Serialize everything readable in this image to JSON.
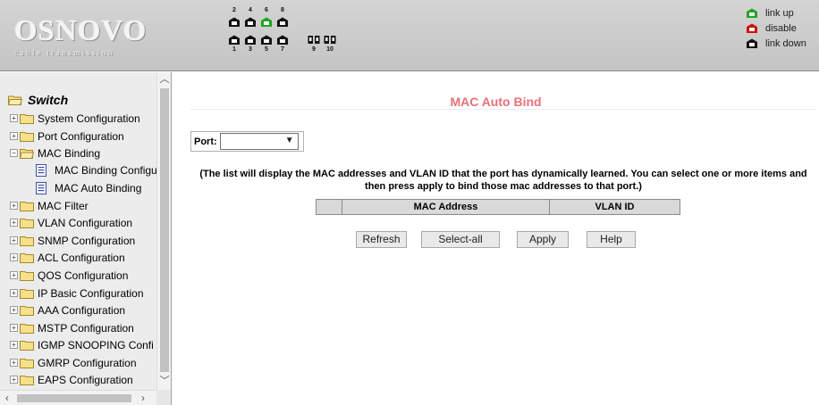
{
  "header": {
    "logo_name": "OSNOVO",
    "logo_tagline": "cable transmission",
    "port_labels_top": [
      "2",
      "4",
      "6",
      "8"
    ],
    "port_labels_bottom": [
      "1",
      "3",
      "5",
      "7",
      "9",
      "10"
    ],
    "ports": [
      {
        "label": "1",
        "status": "link down"
      },
      {
        "label": "2",
        "status": "link down"
      },
      {
        "label": "3",
        "status": "link down"
      },
      {
        "label": "4",
        "status": "link down"
      },
      {
        "label": "5",
        "status": "link down"
      },
      {
        "label": "6",
        "status": "link up"
      },
      {
        "label": "7",
        "status": "link down"
      },
      {
        "label": "8",
        "status": "link down"
      },
      {
        "label": "9",
        "status": "link down"
      },
      {
        "label": "10",
        "status": "link down"
      }
    ],
    "legend": [
      {
        "label": "link up",
        "color": "#1fa51f"
      },
      {
        "label": "disable",
        "color": "#cc1111"
      },
      {
        "label": "link down",
        "color": "#111111"
      }
    ]
  },
  "sidebar": {
    "root_label": "Switch",
    "items": [
      {
        "label": "System Configuration",
        "type": "folder",
        "expanded": false
      },
      {
        "label": "Port Configuration",
        "type": "folder",
        "expanded": false
      },
      {
        "label": "MAC Binding",
        "type": "folder",
        "expanded": true
      },
      {
        "label": "MAC Binding Configu",
        "type": "page"
      },
      {
        "label": "MAC Auto Binding",
        "type": "page"
      },
      {
        "label": "MAC Filter",
        "type": "folder",
        "expanded": false
      },
      {
        "label": "VLAN Configuration",
        "type": "folder",
        "expanded": false
      },
      {
        "label": "SNMP Configuration",
        "type": "folder",
        "expanded": false
      },
      {
        "label": "ACL Configuration",
        "type": "folder",
        "expanded": false
      },
      {
        "label": "QOS Configuration",
        "type": "folder",
        "expanded": false
      },
      {
        "label": "IP Basic Configuration",
        "type": "folder",
        "expanded": false
      },
      {
        "label": "AAA Configuration",
        "type": "folder",
        "expanded": false
      },
      {
        "label": "MSTP Configuration",
        "type": "folder",
        "expanded": false
      },
      {
        "label": "IGMP SNOOPING Confi",
        "type": "folder",
        "expanded": false
      },
      {
        "label": "GMRP Configuration",
        "type": "folder",
        "expanded": false
      },
      {
        "label": "EAPS Configuration",
        "type": "folder",
        "expanded": false
      }
    ]
  },
  "main": {
    "title": "MAC Auto Bind",
    "port_label": "Port:",
    "port_value": "",
    "note": "(The list will display the MAC addresses and VLAN ID that the port has dynamically learned. You can select one or more items and then press apply to bind those mac addresses to that port.)",
    "table_headers": [
      "",
      "MAC Address",
      "VLAN ID"
    ],
    "buttons": {
      "refresh": "Refresh",
      "select_all": "Select-all",
      "apply": "Apply",
      "help": "Help"
    }
  }
}
